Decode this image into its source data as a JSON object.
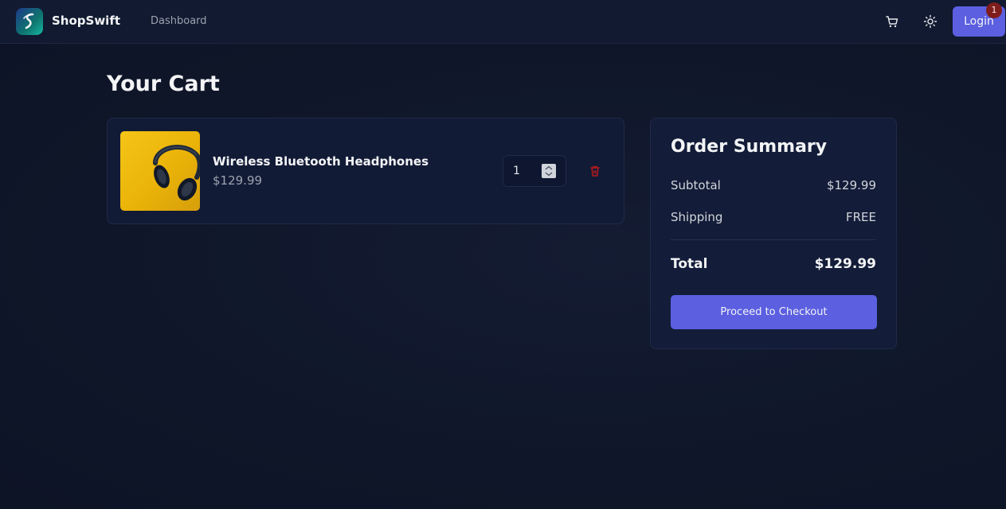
{
  "navbar": {
    "brand": "ShopSwift",
    "logo_icon": "brand-s-logo-icon",
    "links": [
      {
        "label": "Dashboard"
      }
    ],
    "cart_icon": "cart-icon",
    "theme_icon": "sun-icon",
    "login_label": "Login",
    "cart_count": "1"
  },
  "page": {
    "title": "Your Cart"
  },
  "cart": {
    "items": [
      {
        "name": "Wireless Bluetooth Headphones",
        "price": "$129.99",
        "quantity": "1",
        "image_icon": "headphones-image",
        "delete_icon": "trash-icon"
      }
    ]
  },
  "summary": {
    "title": "Order Summary",
    "subtotal_label": "Subtotal",
    "subtotal_value": "$129.99",
    "shipping_label": "Shipping",
    "shipping_value": "FREE",
    "total_label": "Total",
    "total_value": "$129.99",
    "checkout_label": "Proceed to Checkout"
  },
  "colors": {
    "background": "#0f1629",
    "accent": "#5b5fe0",
    "badge": "#7f1d1d",
    "delete": "#b91c1c"
  }
}
